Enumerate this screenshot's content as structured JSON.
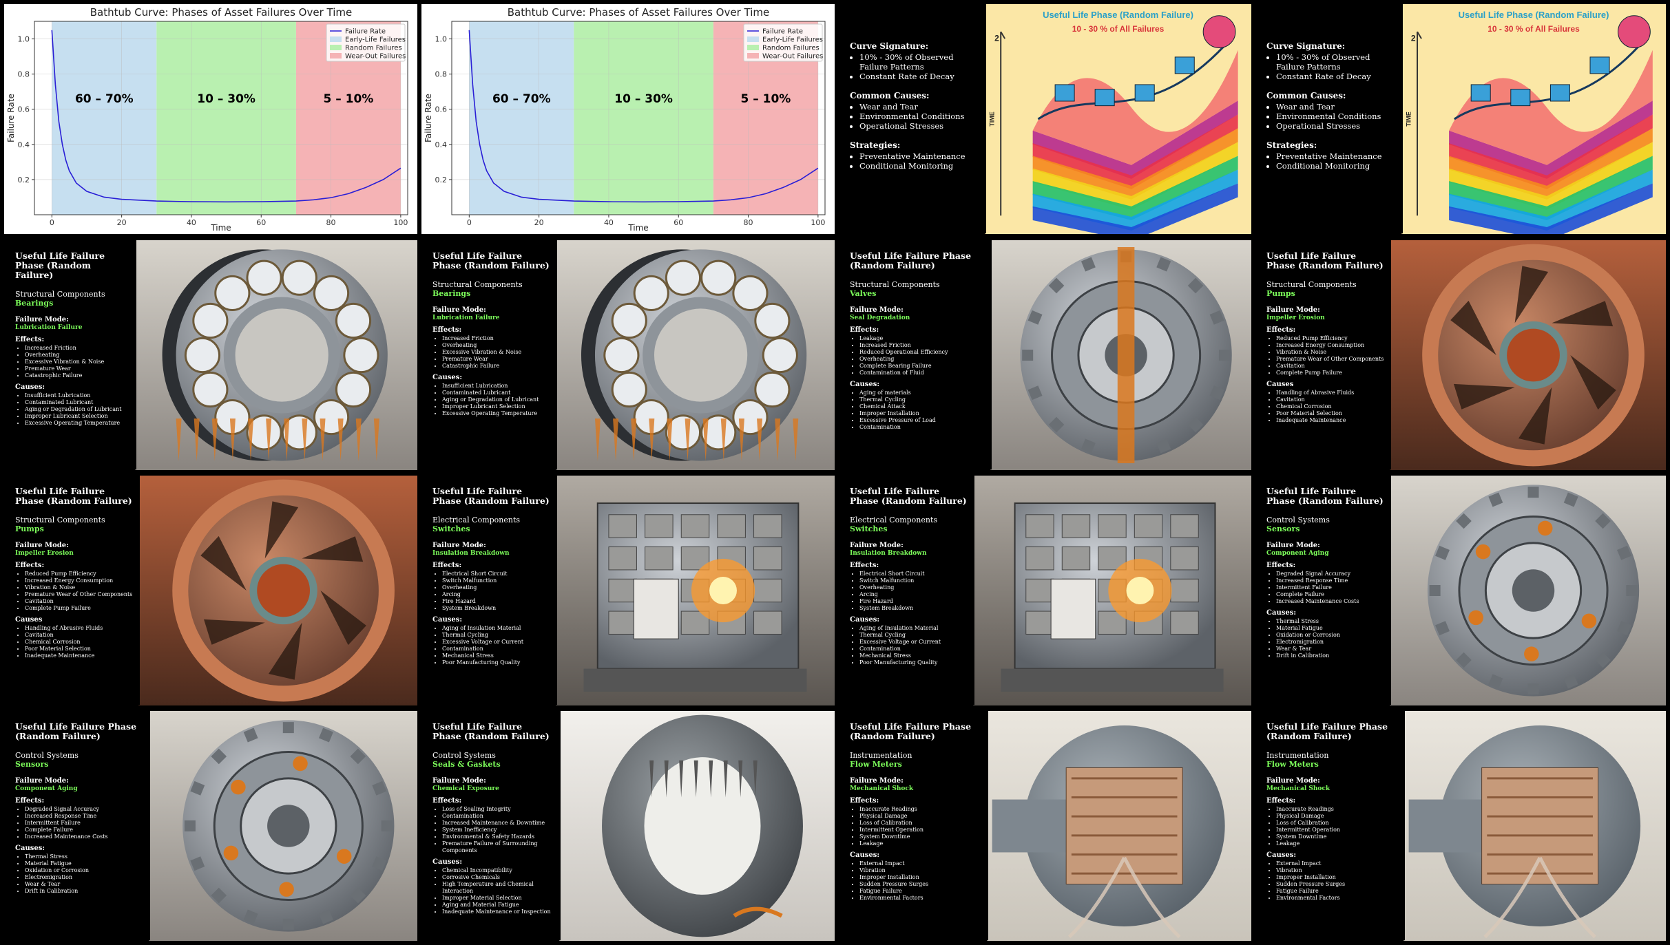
{
  "chart_data": [
    {
      "type": "line",
      "title": "Bathtub Curve: Phases of Asset Failures Over Time",
      "xlabel": "Time",
      "ylabel": "Failure Rate",
      "xlim": [
        -5,
        102
      ],
      "ylim": [
        0,
        1.1
      ],
      "xticks": [
        0,
        20,
        40,
        60,
        80,
        100
      ],
      "yticks": [
        0.2,
        0.4,
        0.6,
        0.8,
        1.0
      ],
      "grid": true,
      "legend": "top-right",
      "series": [
        {
          "name": "Failure Rate",
          "color": "#2a1fd6",
          "x": [
            0,
            1,
            2,
            3,
            4,
            5,
            7,
            10,
            15,
            20,
            30,
            40,
            50,
            60,
            70,
            75,
            80,
            85,
            90,
            95,
            100
          ],
          "y": [
            1.05,
            0.74,
            0.53,
            0.4,
            0.31,
            0.25,
            0.18,
            0.133,
            0.1,
            0.088,
            0.078,
            0.074,
            0.073,
            0.074,
            0.078,
            0.085,
            0.097,
            0.12,
            0.155,
            0.2,
            0.265
          ]
        }
      ],
      "regions": [
        {
          "name": "Early-Life Failures",
          "from": 0,
          "to": 30,
          "color": "#c6dff0",
          "label": "60 – 70%"
        },
        {
          "name": "Random Failures",
          "from": 30,
          "to": 70,
          "color": "#b9f0b0",
          "label": "10 – 30%"
        },
        {
          "name": "Wear-Out Failures",
          "from": 70,
          "to": 100,
          "color": "#f5b3b5",
          "label": "5 – 10%"
        }
      ]
    }
  ],
  "colors": {
    "accent_green": "#7CFC5A",
    "background": "#000000"
  },
  "signature": {
    "h1": "Curve Signature:",
    "items1": [
      "10% - 30% of Observed Failure Patterns",
      "Constant Rate of Decay"
    ],
    "h2": "Common Causes:",
    "items2": [
      "Wear and Tear",
      "Environmental Conditions",
      "Operational Stresses"
    ],
    "h3": "Strategies:",
    "items3": [
      "Preventative Maintenance",
      "Conditional Monitoring"
    ],
    "img_title": "Useful Life Phase (Random Failure)",
    "img_sub": "10 - 30 % of All Failures",
    "axis_time": "TIME",
    "axis_num": "2"
  },
  "slides": {
    "bearings": {
      "title": "Useful Life Failure Phase (Random Failure)",
      "category": "Structural Components",
      "component": "Bearings",
      "mode_label": "Failure Mode:",
      "mode": "Lubrication Failure",
      "effects_label": "Effects:",
      "effects": [
        "Increased Friction",
        "Overheating",
        "Excessive Vibration & Noise",
        "Premature Wear",
        "Catastrophic Failure"
      ],
      "causes_label": "Causes:",
      "causes": [
        "Insufficient Lubrication",
        "Contaminated Lubricant",
        "Aging or Degradation of Lubricant",
        "Improper Lubricant Selection",
        "Excessive Operating Temperature"
      ],
      "icon": "ball-bearing-image"
    },
    "valves": {
      "title": "Useful Life Failure Phase (Random Failure)",
      "category": "Structural Components",
      "component": "Valves",
      "mode_label": "Failure Mode:",
      "mode": "Seal Degradation",
      "effects_label": "Effects:",
      "effects": [
        "Leakage",
        "Increased Friction",
        "Reduced Operational Efficiency",
        "Overheating",
        "Complete Bearing Failure",
        "Contamination of Fluid"
      ],
      "causes_label": "Causes:",
      "causes": [
        "Aging of materials",
        "Thermal Cycling",
        "Chemical Attack",
        "Improper Installation",
        "Excessive Pressure of Load",
        "Contamination"
      ],
      "icon": "valve-image"
    },
    "pumps": {
      "title": "Useful Life Failure Phase (Random Failure)",
      "category": "Structural Components",
      "component": "Pumps",
      "mode_label": "Failure Mode:",
      "mode": "Impeller Erosion",
      "effects_label": "Effects:",
      "effects": [
        "Reduced Pump Efficiency",
        "Increased Energy Consumption",
        "Vibration & Noise",
        "Premature Wear of Other Components",
        "Cavitation",
        "Complete Pump Failure"
      ],
      "causes_label": "Causes",
      "causes": [
        "Handling of Abrasive Fluids",
        "Cavitation",
        "Chemical Corrosion",
        "Poor Material Selection",
        "Inadequate Maintenance"
      ],
      "icon": "pump-impeller-image"
    },
    "switches": {
      "title": "Useful Life Failure Phase (Random Failure)",
      "category": "Electrical Components",
      "component": "Switches",
      "mode_label": "Failure Mode:",
      "mode": "Insulation Breakdown",
      "effects_label": "Effects:",
      "effects": [
        "Electrical Short Circuit",
        "Switch Malfunction",
        "Overheating",
        "Arcing",
        "Fire Hazard",
        "System Breakdown"
      ],
      "causes_label": "Causes:",
      "causes": [
        "Aging of Insulation Material",
        "Thermal Cycling",
        "Excessive Voltage or Current",
        "Contamination",
        "Mechanical Stress",
        "Poor Manufacturing Quality"
      ],
      "icon": "electrical-switch-image"
    },
    "sensors": {
      "title": "Useful Life Failure Phase (Random Failure)",
      "category": "Control Systems",
      "component": "Sensors",
      "mode_label": "Failure Mode:",
      "mode": "Component Aging",
      "effects_label": "Effects:",
      "effects": [
        "Degraded Signal Accuracy",
        "Increased Response Time",
        "Intermittent Failure",
        "Complete Failure",
        "Increased Maintenance Costs"
      ],
      "causes_label": "Causes:",
      "causes": [
        "Thermal Stress",
        "Material Fatigue",
        "Oxidation or Corrosion",
        "Electromigration",
        "Wear & Tear",
        "Drift in Calibration"
      ],
      "icon": "sensor-image"
    },
    "seals": {
      "title": "Useful Life Failure Phase (Random Failure)",
      "category": "Control Systems",
      "component": "Seals & Gaskets",
      "mode_label": "Failure Mode:",
      "mode": "Chemical Exposure",
      "effects_label": "Effects:",
      "effects": [
        "Loss of Sealing Integrity",
        "Contamination",
        "Increased Maintenance & Downtime",
        "System Inefficiency",
        "Environmental & Safety Hazards",
        "Premature Failure of Surrounding Components"
      ],
      "causes_label": "Causes:",
      "causes": [
        "Chemical Incompatibility",
        "Corrosive Chemicals",
        "High Temperature and Chemical Interaction",
        "Improper Material Selection",
        "Aging and Material Fatigue",
        "Inadequate Maintenance or Inspection"
      ],
      "icon": "seal-gasket-image"
    },
    "flowmeters": {
      "title": "Useful Life Failure Phase (Random Failure)",
      "category": "Instrumentation",
      "component": "Flow Meters",
      "mode_label": "Failure Mode:",
      "mode": "Mechanical Shock",
      "effects_label": "Effects:",
      "effects": [
        "Inaccurate Readings",
        "Physical Damage",
        "Loss of Calibration",
        "Intermittent Operation",
        "System Downtime",
        "Leakage"
      ],
      "causes_label": "Causes:",
      "causes": [
        "External Impact",
        "Vibration",
        "Improper Installation",
        "Sudden Pressure Surges",
        "Fatigue Failure",
        "Environmental Factors"
      ],
      "icon": "flow-meter-image"
    }
  }
}
